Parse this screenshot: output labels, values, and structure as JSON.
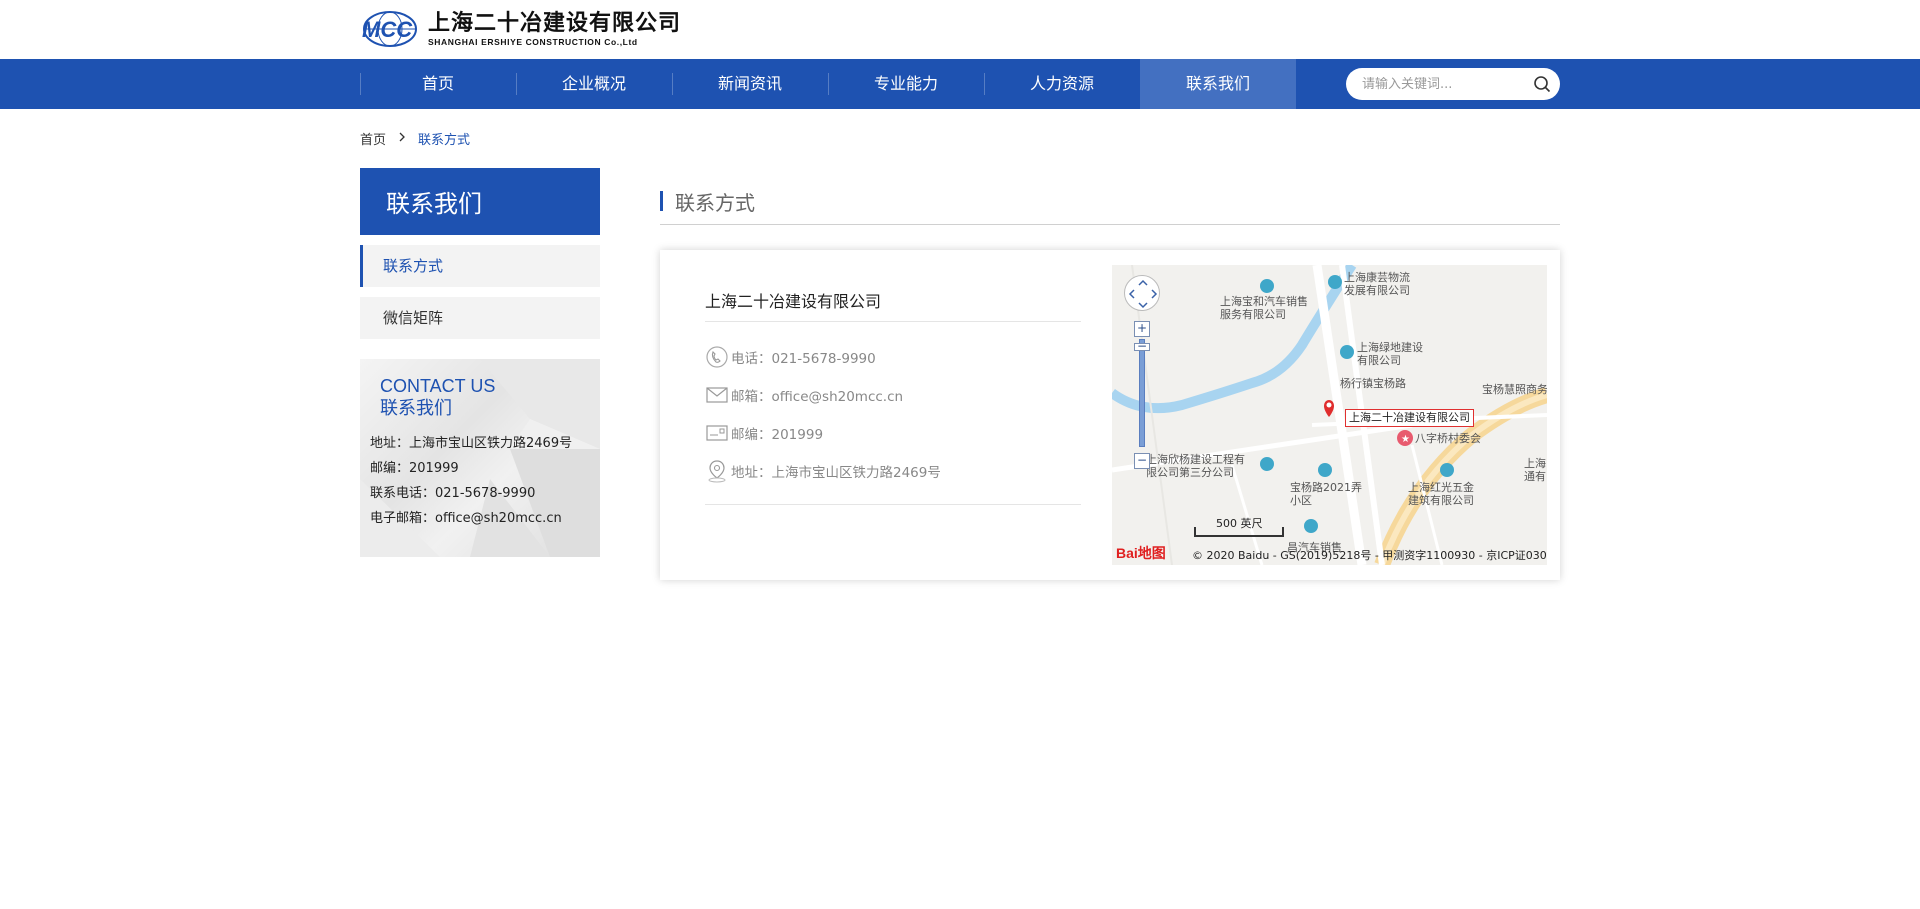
{
  "header": {
    "logo_cn": "上海二十冶建设有限公司",
    "logo_en": "SHANGHAI ERSHIYE CONSTRUCTION Co.,Ltd",
    "logo_mark": "MCC"
  },
  "nav": {
    "items": [
      {
        "label": "首页"
      },
      {
        "label": "企业概况"
      },
      {
        "label": "新闻资讯"
      },
      {
        "label": "专业能力"
      },
      {
        "label": "人力资源"
      },
      {
        "label": "联系我们",
        "active": true
      }
    ],
    "search_placeholder": "请输入关键词..."
  },
  "breadcrumb": {
    "home": "首页",
    "current": "联系方式"
  },
  "sidebar": {
    "title": "联系我们",
    "items": [
      {
        "label": "联系方式",
        "active": true
      },
      {
        "label": "微信矩阵"
      }
    ],
    "contact": {
      "title_en": "CONTACT US",
      "title_cn": "联系我们",
      "address": "地址：上海市宝山区铁力路2469号",
      "zip": "邮编：201999",
      "phone": "联系电话：021-5678-9990",
      "email": "电子邮箱：office@sh20mcc.cn"
    }
  },
  "main": {
    "title": "联系方式",
    "company": "上海二十冶建设有限公司",
    "phone": "电话：021-5678-9990",
    "email": "邮箱：office@sh20mcc.cn",
    "zip": "邮编：201999",
    "address": "地址：上海市宝山区铁力路2469号"
  },
  "map": {
    "labels": {
      "l1": "上海康芸物流",
      "l1b": "发展有限公司",
      "l2": "上海宝和汽车销售",
      "l2b": "服务有限公司",
      "l3": "上海绿地建设",
      "l3b": "有限公司",
      "l4": "杨行镇宝杨路",
      "l5": "宝杨慧照商务",
      "l6": "八字桥村委会",
      "l7": "上海欣杨建设工程有",
      "l7b": "限公司第三分公司",
      "l8": "宝杨路2021弄",
      "l8b": "小区",
      "l9": "上海红光五金",
      "l9b": "建筑有限公司",
      "l10": "上海",
      "l10b": "通有",
      "l11": "昌汽车销售"
    },
    "marker": "上海二十冶建设有限公司",
    "scale": "500 英尺",
    "copyright": "© 2020 Baidu - GS(2019)5218号 - 甲测资字1100930 - 京ICP证030",
    "logo": "Bai地图"
  },
  "colors": {
    "brand": "#1e52b1",
    "nav_active": "#4370c1"
  }
}
